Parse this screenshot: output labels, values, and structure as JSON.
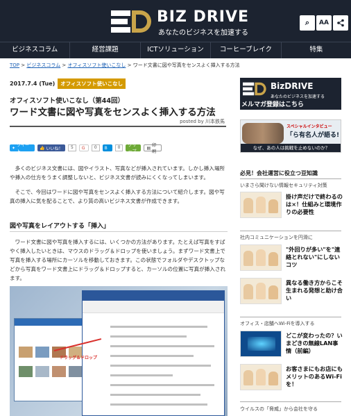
{
  "header": {
    "logo_text": "BIZ DRIVE",
    "logo_sub": "あなたのビジネスを加速する",
    "buttons": [
      {
        "icon": "search-icon",
        "glyph": "⌕"
      },
      {
        "icon": "font-size-icon",
        "glyph": "AA"
      },
      {
        "icon": "share-icon",
        "glyph": "<"
      }
    ]
  },
  "nav": {
    "items": [
      "ビジネスコラム",
      "経営課題",
      "ICTソリューション",
      "コーヒーブレイク",
      "特集"
    ]
  },
  "breadcrumb": {
    "items": [
      "TOP",
      "ビジネスコラム",
      "オフィスソフト使いこなし"
    ],
    "current": "ワード文書に図や写真をセンスよく挿入する方法",
    "separator": ">"
  },
  "article": {
    "date": "2017.7.4 (Tue)",
    "category": "オフィスソフト使いこなし",
    "series": "オフィスソフト使いこなし（第44回）",
    "title": "ワード文書に図や写真をセンスよく挿入する方法",
    "author": "posted by 川本鉄馬",
    "share": {
      "tweet": "ツイート",
      "like": "いいね！",
      "like_count": "5",
      "gplus": "G",
      "gplus_count": "0",
      "hatena": "B",
      "hatena_count": "0",
      "clip": "クリップ",
      "print": "印刷"
    },
    "para1": "　多くのビジネス文書には、図やイラスト、写真などが挿入されています。しかし挿入場所や挿入の仕方をうまく調整しないと、ビジネス文書が読みにくくなってしまいます。",
    "para2": "　そこで、今回はワードに図や写真をセンスよく挿入する方法について紹介します。図や写真の挿入に気を配ることで、より質の高いビジネス文書が作成できます。",
    "h2": "図や写真をレイアウトする「挿入」",
    "para3": "　ワード文書に図や写真を挿入するには、いくつかの方法があります。たとえば写真をすばやく挿入したいときは、マウスのドラッグ＆ドロップを使いましょう。まずワード文書上で写真を挿入する場所にカーソルを移動しておきます。この状態でフォルダやデスクトップなどから写真をワード文書上にドラッグ＆ドロップすると、カーソルの位置に写真が挿入されます。",
    "figure_label": "ドラッグ＆ドロップ"
  },
  "sidebar": {
    "banner1": {
      "title": "BizDRIVE",
      "sub": "あなたのビジネスを加速する",
      "cta": "メルマガ登録はこちら"
    },
    "banner2": {
      "tag": "スペシャルインタビュー",
      "headline": "「ら有名人が語る!",
      "bar": "なぜ、あの人は挑戦を止めないのか？"
    },
    "section1": {
      "heading": "必見！会社運営に役立つ豆知識",
      "sub": "いまさら聞けない情報セキュリティ対策",
      "items": [
        {
          "title": "掛け声だけで終わるのは×！仕組みと環境作りの必要性"
        }
      ]
    },
    "section2": {
      "sub": "社内コミュニケーションを円滑に",
      "items": [
        {
          "title": "\"外回りが多い\"を\"連絡とれない\"にしないコツ"
        },
        {
          "title": "異なる働き方からこそ生まれる発想と助け合い"
        }
      ]
    },
    "section3": {
      "sub": "オフィス・店舗へWi-Fiを導入する",
      "items": [
        {
          "title": "どこが変わったの？いまどきの無線LAN事情（前編）"
        },
        {
          "title": "お客さまにもお店にもメリットのあるWi-Fiを！"
        }
      ]
    },
    "section4": {
      "sub": "ウイルスの「脅威」から会社を守る"
    }
  }
}
